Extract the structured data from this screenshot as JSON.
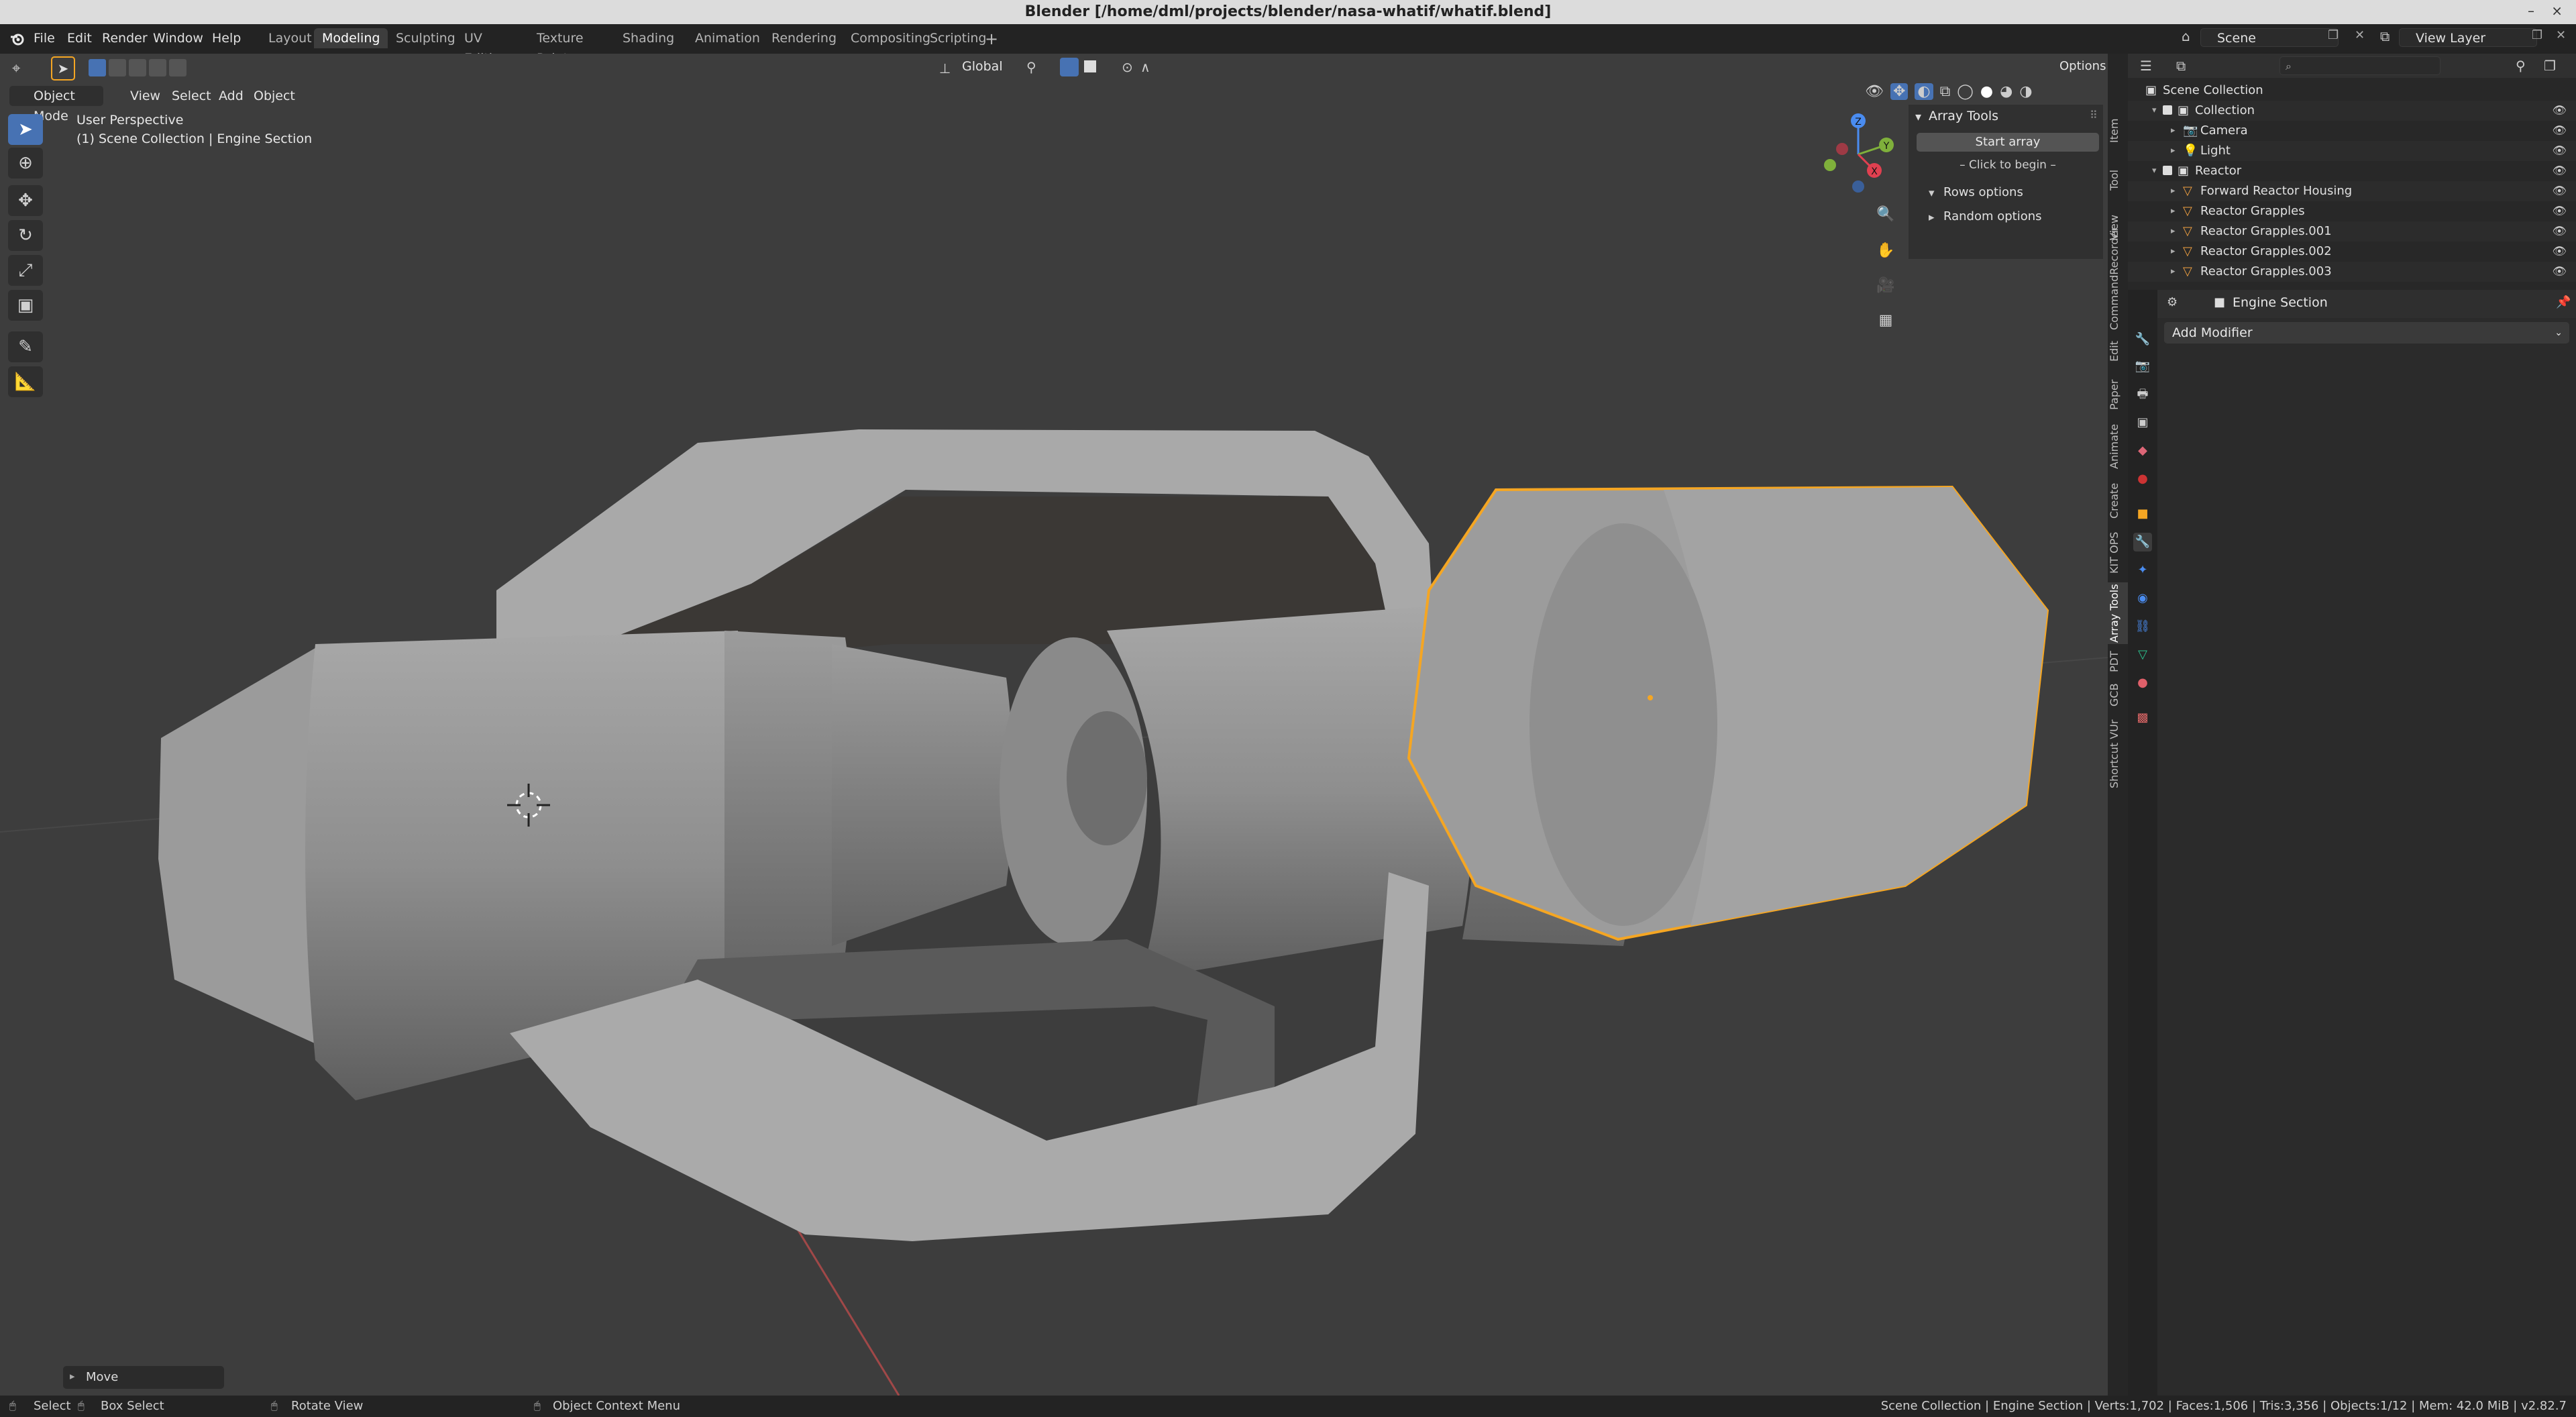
{
  "window": {
    "title": "Blender [/home/dml/projects/blender/nasa-whatif/whatif.blend]",
    "min": "–",
    "close": "×"
  },
  "menu": {
    "file": "File",
    "edit": "Edit",
    "render": "Render",
    "window": "Window",
    "help": "Help"
  },
  "workspaces": [
    "Layout",
    "Modeling",
    "Sculpting",
    "UV Editing",
    "Texture Paint",
    "Shading",
    "Animation",
    "Rendering",
    "Compositing",
    "Scripting"
  ],
  "active_workspace": "Modeling",
  "scene": {
    "label": "Scene",
    "view_layer": "View Layer"
  },
  "viewport": {
    "mode": "Object Mode",
    "menus": {
      "view": "View",
      "select": "Select",
      "add": "Add",
      "object": "Object"
    },
    "transform_orientation": "Global",
    "options": "Options",
    "overlay_title": "User Perspective",
    "overlay_sub": "(1) Scene Collection | Engine Section",
    "gizmo": {
      "x": "X",
      "y": "Y",
      "z": "Z"
    },
    "last_op": "Move"
  },
  "npanel": {
    "title": "Array Tools",
    "start_button": "Start array",
    "click_hint": "– Click to begin –",
    "rows_options": "Rows options",
    "random_options": "Random options"
  },
  "side_tabs": [
    "Item",
    "Tool",
    "View",
    "CommandRecorder",
    "Edit",
    "Paper",
    "Animate",
    "Create",
    "KIT OPS",
    "Array Tools",
    "PDT",
    "GCB",
    "Shortcut VUr"
  ],
  "outliner": {
    "rows": [
      {
        "label": "Scene Collection",
        "indent": 0,
        "icon": "collection"
      },
      {
        "label": "Collection",
        "indent": 1,
        "icon": "collection"
      },
      {
        "label": "Camera",
        "indent": 2,
        "icon": "camera"
      },
      {
        "label": "Light",
        "indent": 2,
        "icon": "light"
      },
      {
        "label": "Reactor",
        "indent": 1,
        "icon": "collection"
      },
      {
        "label": "Forward Reactor Housing",
        "indent": 2,
        "icon": "mesh"
      },
      {
        "label": "Reactor Grapples",
        "indent": 2,
        "icon": "mesh"
      },
      {
        "label": "Reactor Grapples.001",
        "indent": 2,
        "icon": "mesh"
      },
      {
        "label": "Reactor Grapples.002",
        "indent": 2,
        "icon": "mesh"
      },
      {
        "label": "Reactor Grapples.003",
        "indent": 2,
        "icon": "mesh"
      }
    ]
  },
  "properties": {
    "object_name": "Engine Section",
    "add_modifier": "Add Modifier"
  },
  "status": {
    "select": "Select",
    "box_select": "Box Select",
    "rotate_view": "Rotate View",
    "context_menu": "Object Context Menu",
    "stats": "Scene Collection | Engine Section | Verts:1,702 | Faces:1,506 | Tris:3,356 | Objects:1/12 | Mem: 42.0 MiB | v2.82.7"
  },
  "colors": {
    "accent": "#4772b3",
    "selection": "#f5a623",
    "viewport_bg": "#3d3d3d"
  }
}
